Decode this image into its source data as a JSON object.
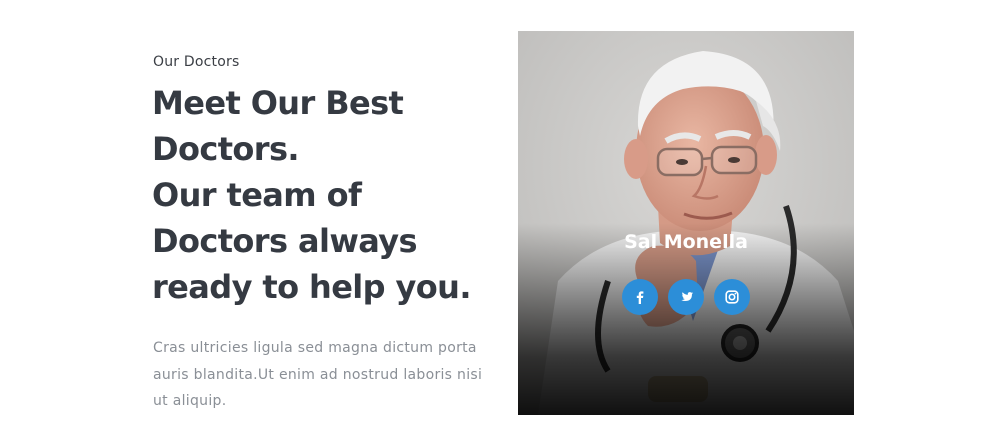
{
  "section": {
    "eyebrow": "Our Doctors",
    "headline_lines": [
      "Meet Our Best",
      "Doctors.",
      "Our team of",
      "Doctors always",
      "ready to help you."
    ],
    "description": "Cras ultricies ligula sed magna dictum porta auris blandita.Ut enim ad nostrud laboris nisi ut aliquip."
  },
  "doctor_card": {
    "name": "Sal Monella",
    "socials": [
      {
        "icon": "facebook-icon"
      },
      {
        "icon": "twitter-icon"
      },
      {
        "icon": "instagram-icon"
      }
    ]
  },
  "colors": {
    "heading": "#353a42",
    "body_text": "#8a8f96",
    "social_button": "#2c8ed8"
  }
}
